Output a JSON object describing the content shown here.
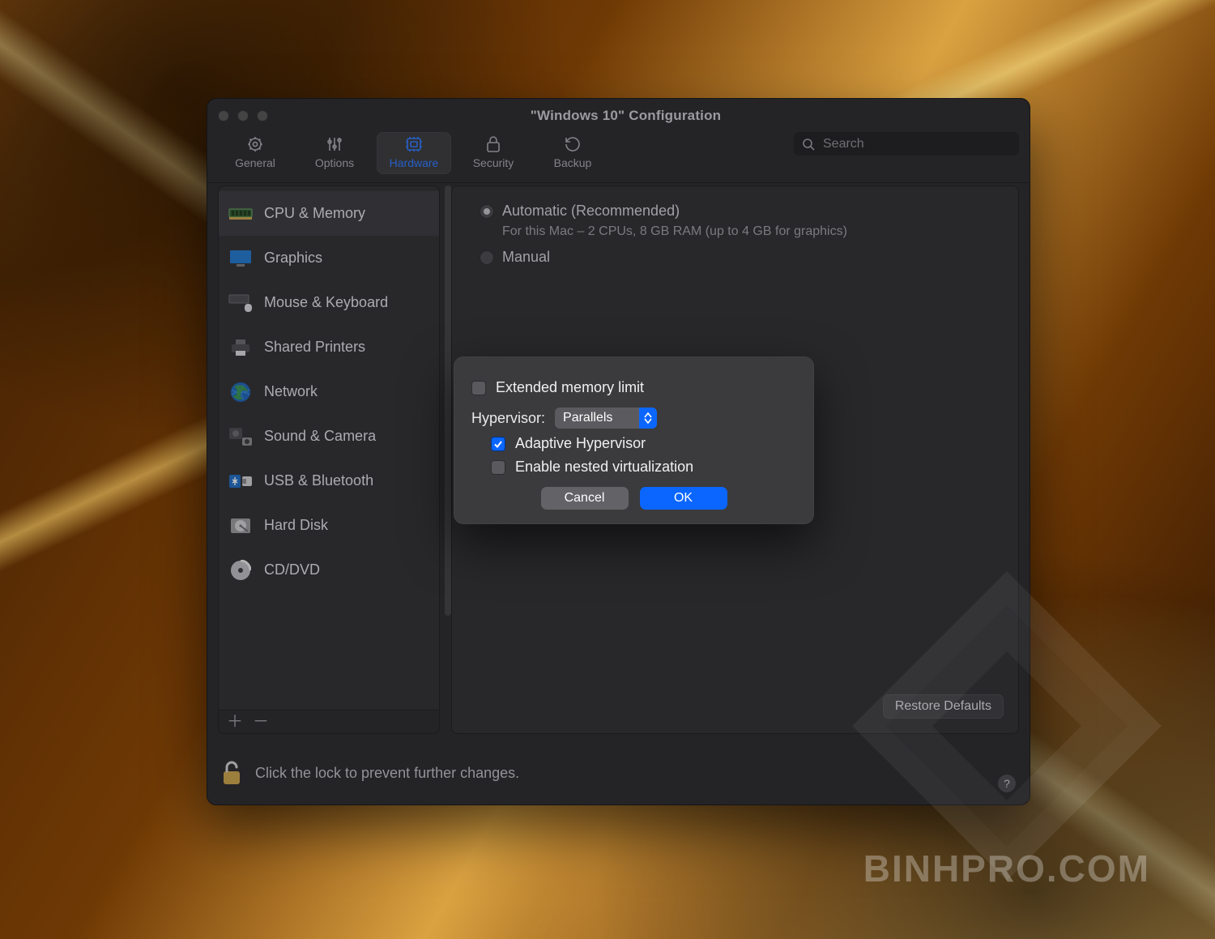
{
  "window": {
    "title": "\"Windows 10\" Configuration"
  },
  "toolbar": {
    "items": [
      {
        "label": "General"
      },
      {
        "label": "Options"
      },
      {
        "label": "Hardware"
      },
      {
        "label": "Security"
      },
      {
        "label": "Backup"
      }
    ],
    "search_placeholder": "Search"
  },
  "sidebar": {
    "items": [
      {
        "label": "CPU & Memory"
      },
      {
        "label": "Graphics"
      },
      {
        "label": "Mouse & Keyboard"
      },
      {
        "label": "Shared Printers"
      },
      {
        "label": "Network"
      },
      {
        "label": "Sound & Camera"
      },
      {
        "label": "USB & Bluetooth"
      },
      {
        "label": "Hard Disk"
      },
      {
        "label": "CD/DVD"
      }
    ]
  },
  "panel": {
    "radio_auto": "Automatic (Recommended)",
    "auto_sub": "For this Mac – 2 CPUs, 8 GB RAM (up to 4 GB for graphics)",
    "radio_manual": "Manual",
    "restore": "Restore Defaults"
  },
  "sheet": {
    "ext_mem": "Extended memory limit",
    "hypervisor_label": "Hypervisor:",
    "hypervisor_value": "Parallels",
    "adaptive": "Adaptive Hypervisor",
    "nested": "Enable nested virtualization",
    "cancel": "Cancel",
    "ok": "OK"
  },
  "lock": {
    "text": "Click the lock to prevent further changes."
  },
  "watermark": "BINHPRO.COM"
}
